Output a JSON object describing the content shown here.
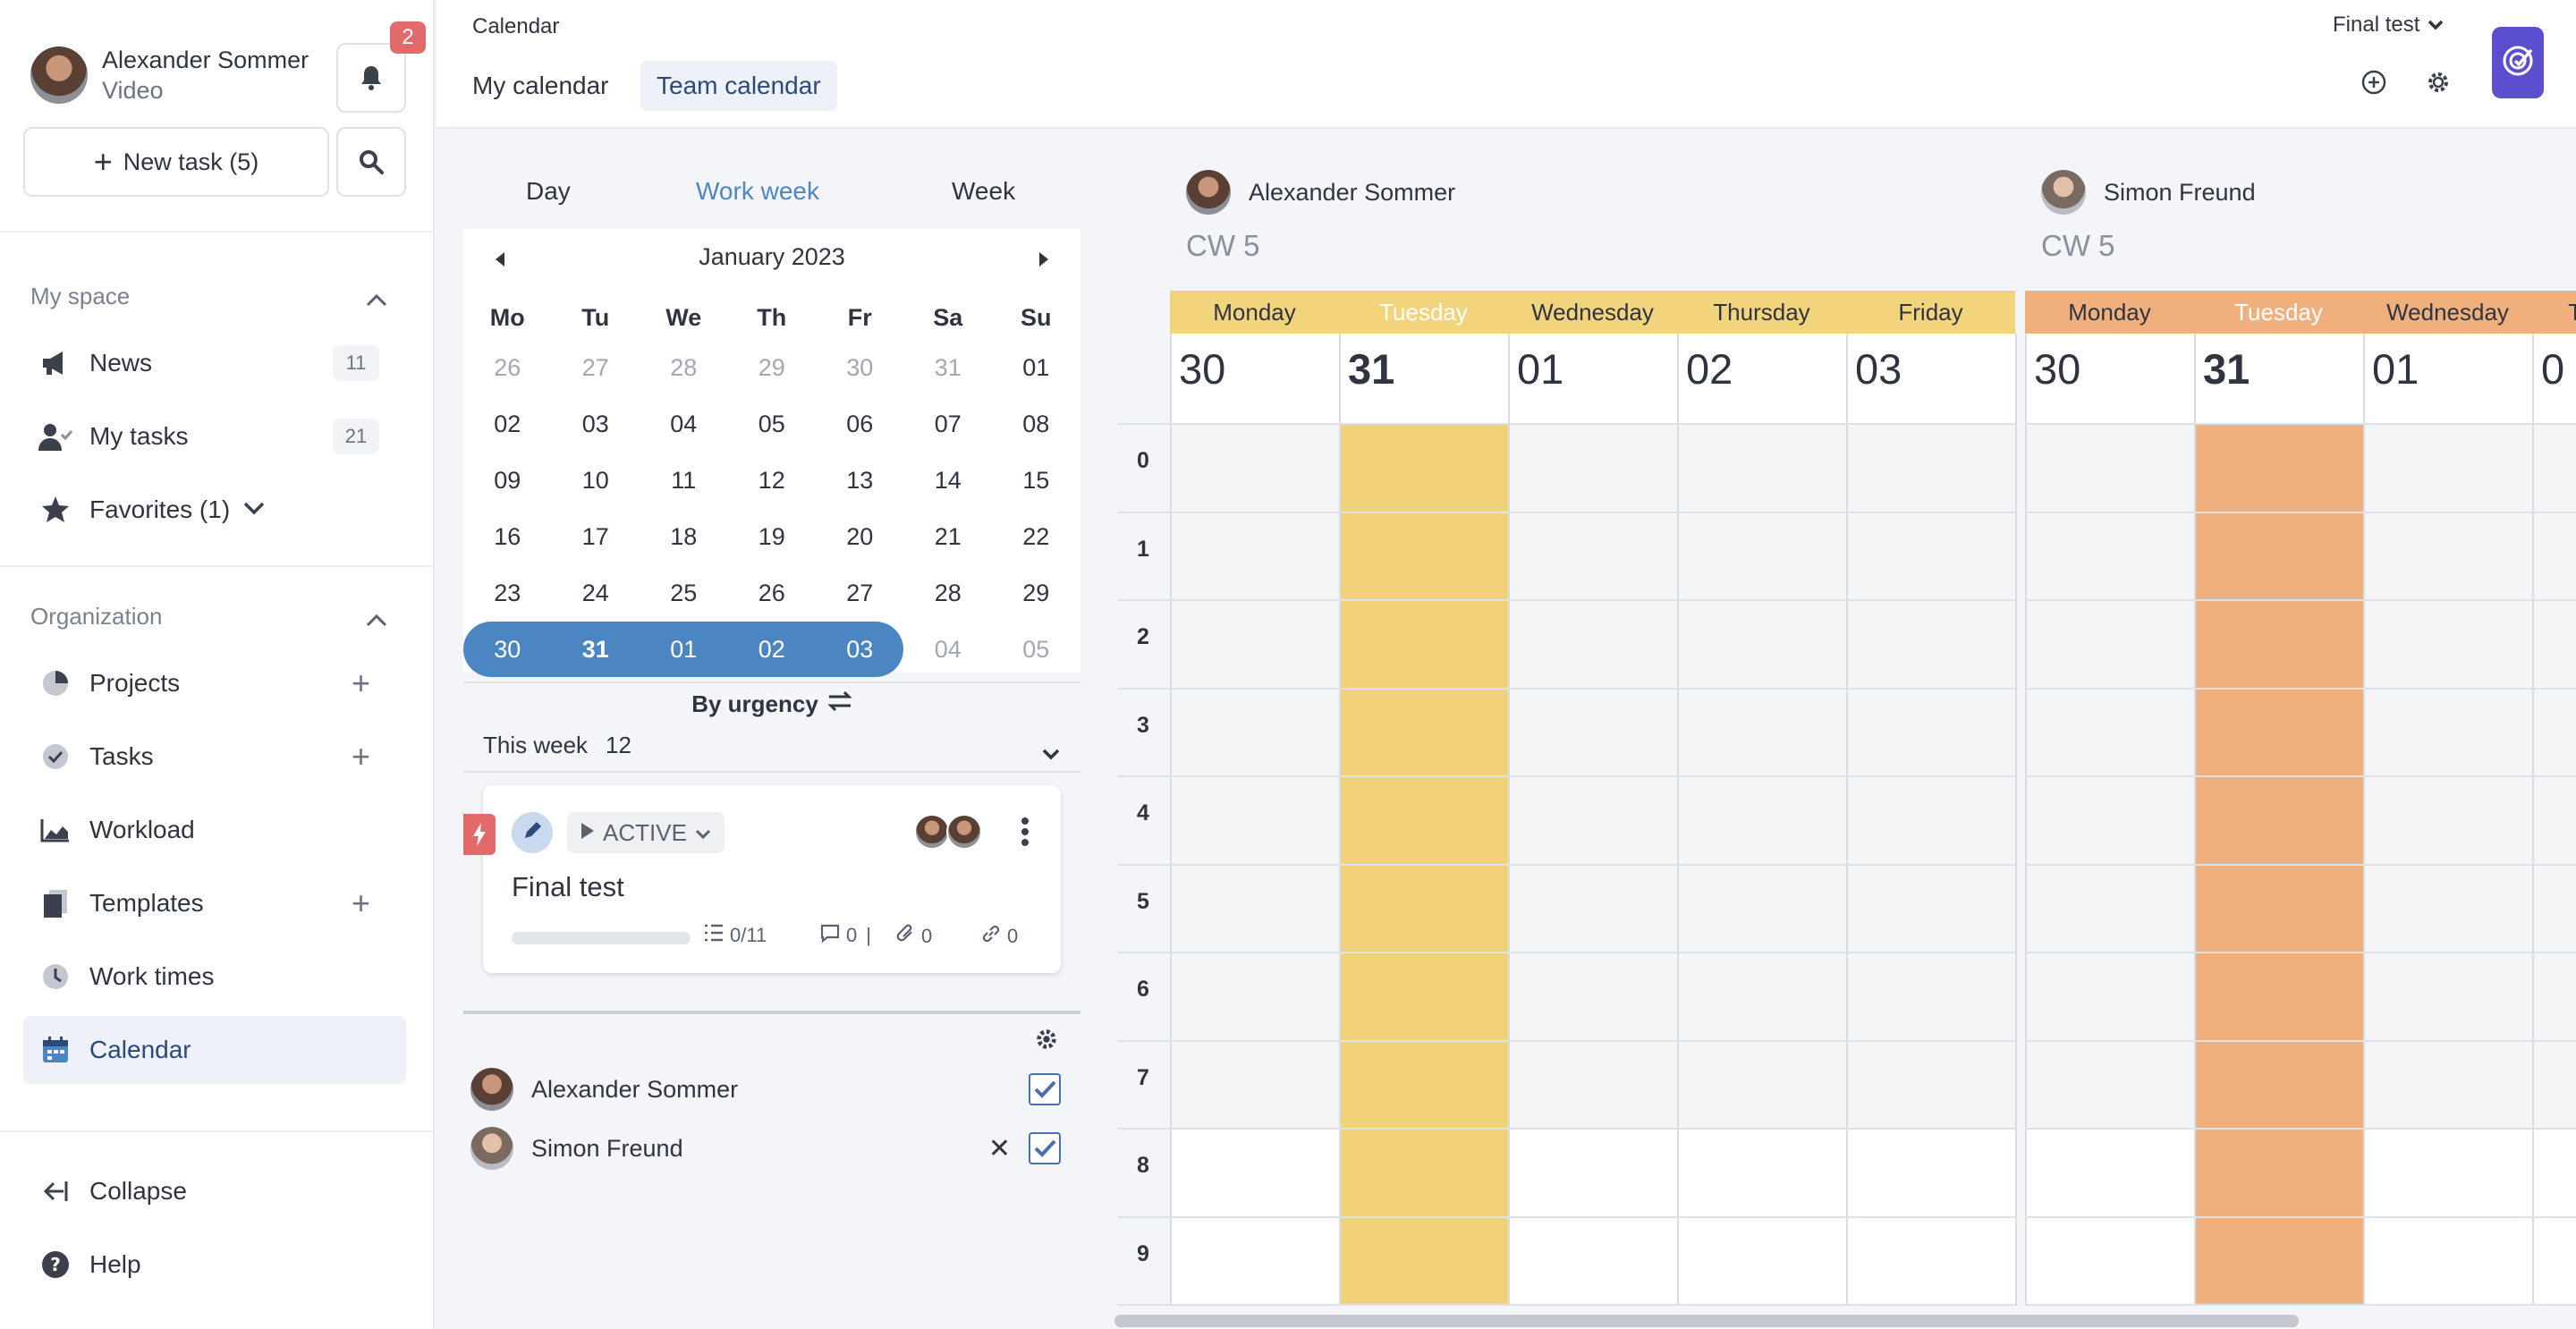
{
  "user": {
    "name": "Alexander Sommer",
    "role": "Video",
    "notifications": "2"
  },
  "sidebar": {
    "new_task": "New task (5)",
    "my_space": {
      "heading": "My space",
      "items": [
        {
          "label": "News",
          "count": "11",
          "icon": "megaphone-icon"
        },
        {
          "label": "My tasks",
          "count": "21",
          "icon": "user-check-icon"
        },
        {
          "label": "Favorites (1)",
          "icon": "star-icon"
        }
      ]
    },
    "organization": {
      "heading": "Organization",
      "items": [
        {
          "label": "Projects",
          "icon": "pie-chart-icon"
        },
        {
          "label": "Tasks",
          "icon": "check-circle-icon"
        },
        {
          "label": "Workload",
          "icon": "area-chart-icon"
        },
        {
          "label": "Templates",
          "icon": "documents-icon"
        },
        {
          "label": "Work times",
          "icon": "clock-icon"
        },
        {
          "label": "Calendar",
          "icon": "calendar-icon"
        }
      ]
    },
    "footer": {
      "collapse": "Collapse",
      "help": "Help"
    }
  },
  "header": {
    "breadcrumb": "Calendar",
    "tabs": [
      "My calendar",
      "Team calendar"
    ],
    "active_tab": "Team calendar",
    "project_select": "Final test",
    "brand_color": "#5b4fcf"
  },
  "panel": {
    "view_tabs": [
      "Day",
      "Work week",
      "Week"
    ],
    "active_view": "Work week",
    "month_label": "January 2023",
    "weekdays": [
      "Mo",
      "Tu",
      "We",
      "Th",
      "Fr",
      "Sa",
      "Su"
    ],
    "weeks": [
      [
        "26",
        "27",
        "28",
        "29",
        "30",
        "31",
        "01"
      ],
      [
        "02",
        "03",
        "04",
        "05",
        "06",
        "07",
        "08"
      ],
      [
        "09",
        "10",
        "11",
        "12",
        "13",
        "14",
        "15"
      ],
      [
        "16",
        "17",
        "18",
        "19",
        "20",
        "21",
        "22"
      ],
      [
        "23",
        "24",
        "25",
        "26",
        "27",
        "28",
        "29"
      ],
      [
        "30",
        "31",
        "01",
        "02",
        "03",
        "04",
        "05"
      ]
    ],
    "sort_label": "By urgency",
    "period_label": "This week",
    "period_count": "12",
    "task": {
      "status": "ACTIVE",
      "title": "Final test",
      "progress_fraction": 0,
      "checklist": "0/11",
      "comments": "0",
      "attachments": "0",
      "links": "0"
    },
    "members": [
      {
        "name": "Alexander Sommer",
        "checked": true
      },
      {
        "name": "Simon Freund",
        "checked": true
      }
    ]
  },
  "team": {
    "hours": [
      "0",
      "1",
      "2",
      "3",
      "4",
      "5",
      "6",
      "7",
      "8",
      "9"
    ],
    "people": [
      {
        "name": "Alexander Sommer",
        "cw": "CW 5",
        "color": "#f1d47c",
        "today_color": "#f0d27a",
        "days": [
          {
            "label": "Monday",
            "num": "30"
          },
          {
            "label": "Tuesday",
            "num": "31"
          },
          {
            "label": "Wednesday",
            "num": "01"
          },
          {
            "label": "Thursday",
            "num": "02"
          },
          {
            "label": "Friday",
            "num": "03"
          }
        ]
      },
      {
        "name": "Simon Freund",
        "cw": "CW 5",
        "color": "#f0b07e",
        "today_color": "#efb07e",
        "days": [
          {
            "label": "Monday",
            "num": "30"
          },
          {
            "label": "Tuesday",
            "num": "31"
          },
          {
            "label": "Wednesday",
            "num": "01"
          },
          {
            "label": "Thursday",
            "num": "0"
          }
        ]
      }
    ]
  }
}
